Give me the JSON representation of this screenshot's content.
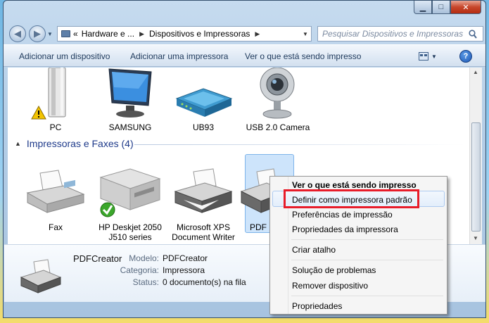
{
  "window": {
    "controls": {
      "minimize": "▁",
      "maximize": "□",
      "close": "✕"
    }
  },
  "address_bar": {
    "overflow": "«",
    "crumbs": [
      "Hardware e ...",
      "Dispositivos e Impressoras"
    ],
    "search_placeholder": "Pesquisar Dispositivos e Impressoras"
  },
  "toolbar": {
    "items": [
      "Adicionar um dispositivo",
      "Adicionar uma impressora",
      "Ver o que está sendo impresso"
    ],
    "help_label": "?"
  },
  "devices": [
    {
      "label": "PC",
      "icon": "computer-warning-icon"
    },
    {
      "label": "SAMSUNG",
      "icon": "monitor-icon"
    },
    {
      "label": "UB93",
      "icon": "router-icon"
    },
    {
      "label": "USB 2.0 Camera",
      "icon": "webcam-icon"
    }
  ],
  "printers_group": {
    "title": "Impressoras e Faxes (4)",
    "items": [
      {
        "label": "Fax",
        "icon": "fax-icon"
      },
      {
        "label_line1": "HP Deskjet 2050",
        "label_line2": "J510 series",
        "icon": "printer-default-icon"
      },
      {
        "label_line1": "Microsoft XPS",
        "label_line2": "Document Writer",
        "icon": "printer-icon"
      },
      {
        "label": "PDF",
        "icon": "printer-icon"
      }
    ]
  },
  "details": {
    "name": "PDFCreator",
    "model_label": "Modelo:",
    "model_value": "PDFCreator",
    "category_label": "Categoria:",
    "category_value": "Impressora",
    "status_label": "Status:",
    "status_value": "0 documento(s) na fila"
  },
  "context_menu": {
    "items": [
      "Ver o que está sendo impresso",
      "Definir como impressora padrão",
      "Preferências de impressão",
      "Propriedades da impressora",
      "Criar atalho",
      "Solução de problemas",
      "Remover dispositivo",
      "Propriedades"
    ],
    "highlight_color": "#e81c2a"
  },
  "colors": {
    "group_header": "#1e3a8a",
    "toolbar_text": "#1e395b"
  }
}
